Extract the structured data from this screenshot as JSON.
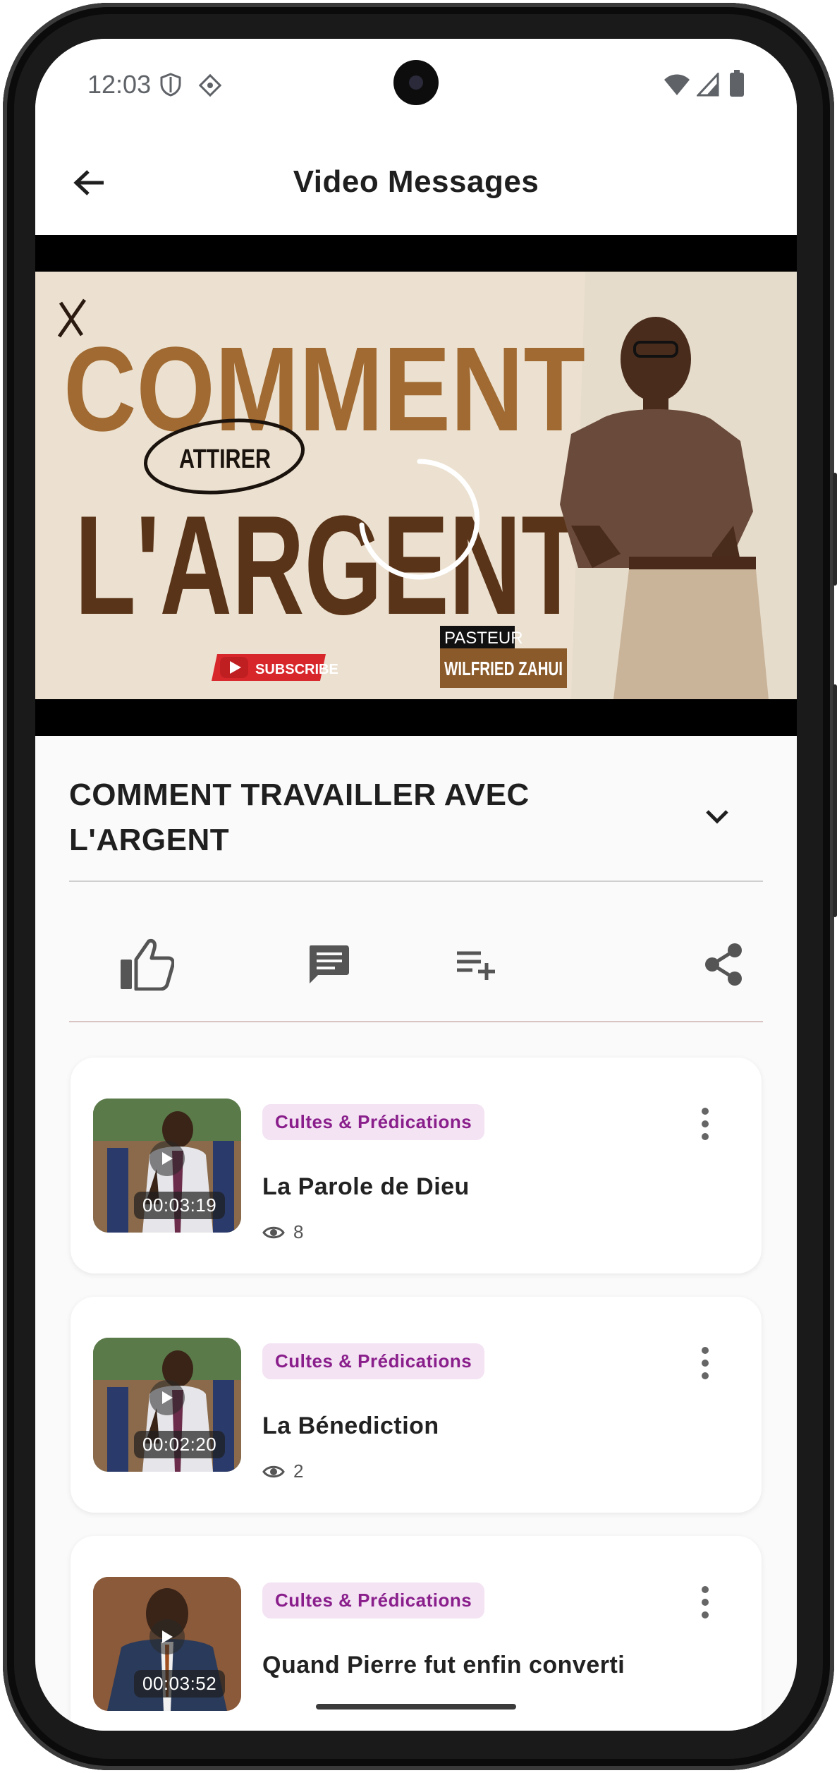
{
  "status_bar": {
    "time": "12:03"
  },
  "app_bar": {
    "title": "Video Messages"
  },
  "player": {
    "thumbnail_text": {
      "word1": "COMMENT",
      "word2": "ATTIRER",
      "word3": "L'ARGENT",
      "subscribe": "SUBSCRIBE",
      "pasteur": "PASTEUR",
      "name": "WILFRIED ZAHUI"
    }
  },
  "video": {
    "title": "COMMENT TRAVAILLER AVEC L'ARGENT"
  },
  "related": [
    {
      "category": "Cultes & Prédications",
      "title": "La Parole de Dieu",
      "duration": "00:03:19",
      "views": "8"
    },
    {
      "category": "Cultes & Prédications",
      "title": "La Bénediction",
      "duration": "00:02:20",
      "views": "2"
    },
    {
      "category": "Cultes & Prédications",
      "title": "Quand Pierre fut enfin converti",
      "duration": "00:03:52",
      "views": ""
    }
  ],
  "colors": {
    "badge_bg": "#f3e3f3",
    "badge_text": "#8a1f8c",
    "thumb_brown": "#a06a32"
  }
}
